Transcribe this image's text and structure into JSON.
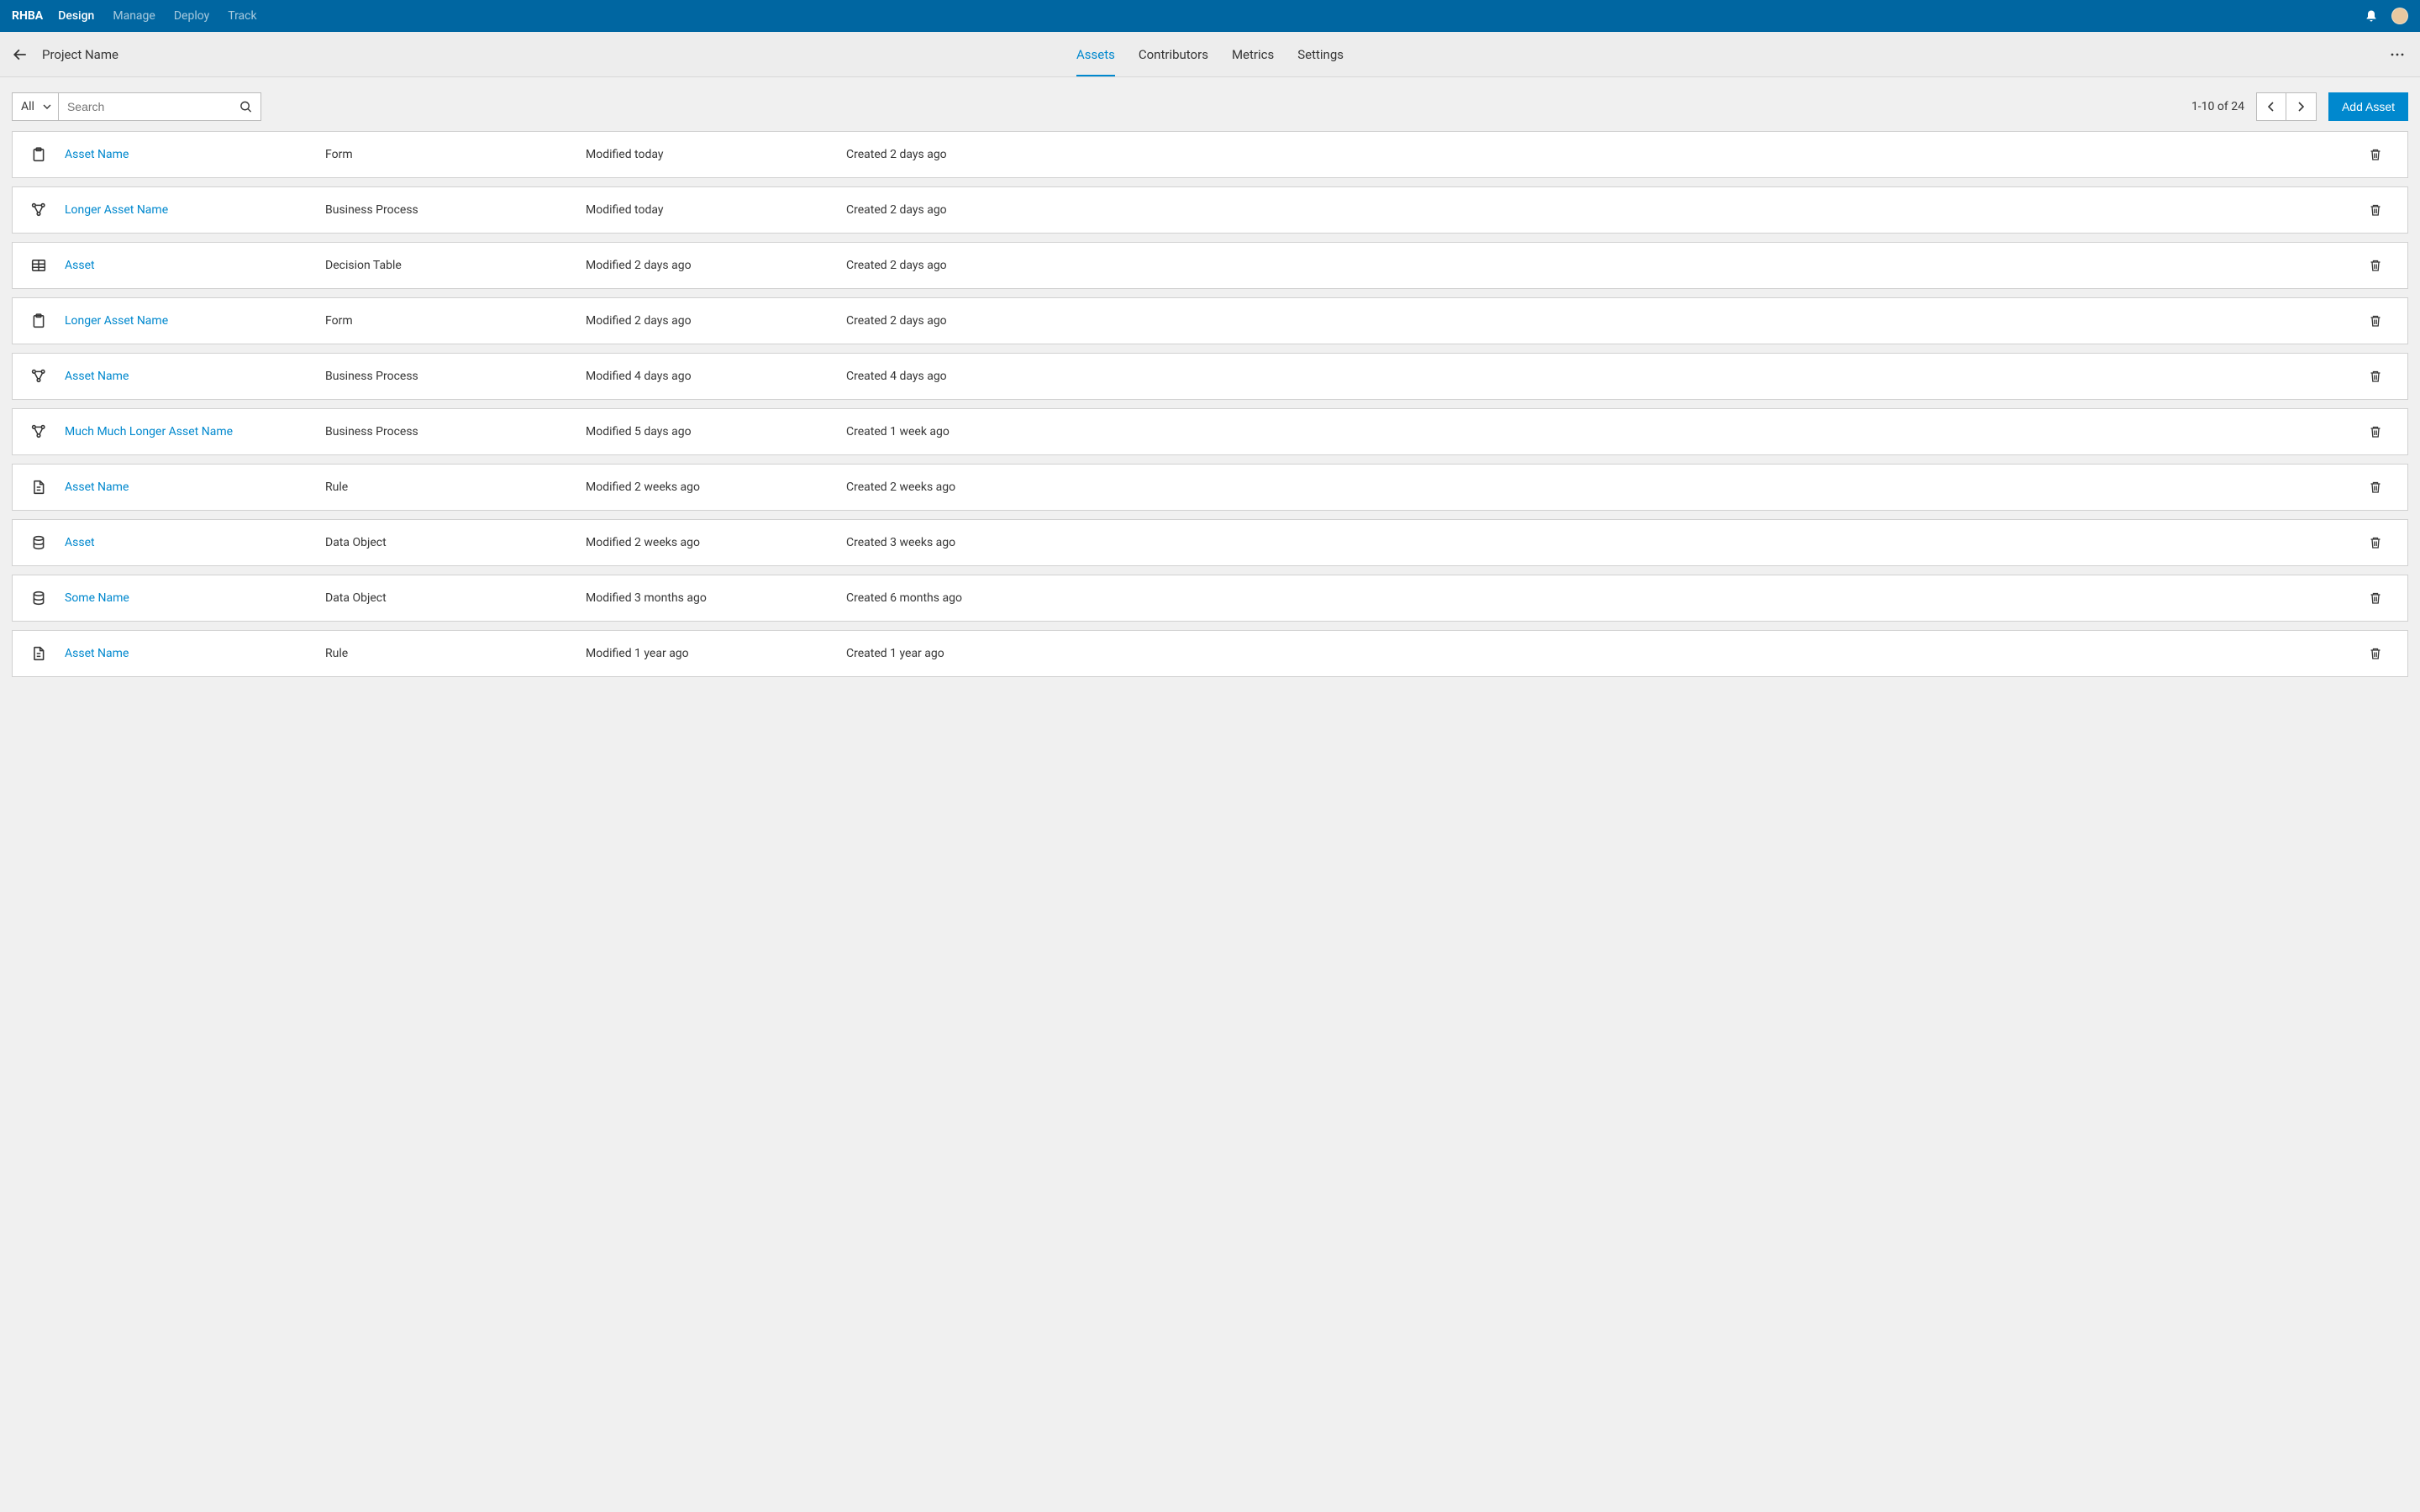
{
  "topbar": {
    "brand": "RHBA",
    "nav": [
      "Design",
      "Manage",
      "Deploy",
      "Track"
    ],
    "active_nav": "Design"
  },
  "subheader": {
    "title": "Project Name",
    "tabs": [
      "Assets",
      "Contributors",
      "Metrics",
      "Settings"
    ],
    "active_tab": "Assets"
  },
  "toolbar": {
    "filter_label": "All",
    "search_placeholder": "Search",
    "page_info": "1-10 of 24",
    "add_label": "Add Asset"
  },
  "assets": [
    {
      "icon": "clipboard",
      "name": "Asset Name",
      "type": "Form",
      "modified": "Modified today",
      "created": "Created 2 days ago"
    },
    {
      "icon": "process",
      "name": "Longer Asset Name",
      "type": "Business Process",
      "modified": "Modified today",
      "created": "Created 2 days ago"
    },
    {
      "icon": "table",
      "name": "Asset",
      "type": "Decision Table",
      "modified": "Modified 2 days ago",
      "created": "Created 2 days ago"
    },
    {
      "icon": "clipboard",
      "name": "Longer Asset Name",
      "type": "Form",
      "modified": "Modified 2 days ago",
      "created": "Created 2 days ago"
    },
    {
      "icon": "process",
      "name": "Asset Name",
      "type": "Business Process",
      "modified": "Modified 4 days ago",
      "created": "Created 4 days ago"
    },
    {
      "icon": "process",
      "name": "Much Much Longer Asset Name",
      "type": "Business Process",
      "modified": "Modified 5 days ago",
      "created": "Created 1 week ago"
    },
    {
      "icon": "document",
      "name": "Asset Name",
      "type": "Rule",
      "modified": "Modified 2 weeks ago",
      "created": "Created 2 weeks ago"
    },
    {
      "icon": "database",
      "name": "Asset",
      "type": "Data Object",
      "modified": "Modified 2 weeks ago",
      "created": "Created 3 weeks ago"
    },
    {
      "icon": "database",
      "name": "Some Name",
      "type": "Data Object",
      "modified": "Modified 3 months ago",
      "created": "Created 6 months ago"
    },
    {
      "icon": "document",
      "name": "Asset Name",
      "type": "Rule",
      "modified": "Modified 1 year ago",
      "created": "Created 1 year ago"
    }
  ]
}
